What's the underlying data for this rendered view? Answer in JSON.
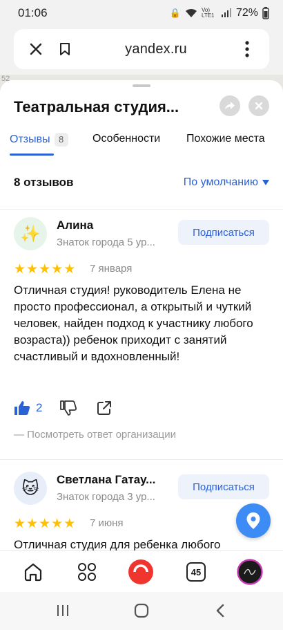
{
  "status": {
    "time": "01:06",
    "battery": "72%",
    "network": "Vo) LTE1"
  },
  "browser": {
    "url": "yandex.ru",
    "close_icon": "close-icon",
    "bookmark_icon": "bookmark-icon",
    "menu_icon": "more-vertical-icon"
  },
  "map": {
    "fragment": "52"
  },
  "place": {
    "title": "Театральная студия..."
  },
  "tabs": [
    {
      "label": "Отзывы",
      "badge": "8",
      "active": true
    },
    {
      "label": "Особенности",
      "active": false
    },
    {
      "label": "Похожие места",
      "active": false
    }
  ],
  "reviews_header": {
    "count": "8 отзывов",
    "sort": "По умолчанию"
  },
  "reviews": [
    {
      "avatar": "✨",
      "avatar_icon": "sparkles-icon",
      "name": "Алина",
      "level": "Знаток города 5 ур...",
      "subscribe": "Подписаться",
      "rating": 5,
      "date": "7 января",
      "text": "Отличная студия! руководитель Елена не просто профессионал, а открытый и чуткий человек, найден подход к участнику любого возраста)) ребенок приходит с занятий счастливый и вдохновленный!",
      "likes": "2",
      "org_reply": "— Посмотреть ответ организации"
    },
    {
      "avatar": "🐱",
      "avatar_icon": "cat-icon",
      "name": "Светлана Гатау...",
      "level": "Знаток города 3 ур...",
      "subscribe": "Подписаться",
      "rating": 5,
      "date": "7 июня",
      "text": "Отличная студия для ребенка любого"
    }
  ],
  "bottom_nav": {
    "tabs_count": "45"
  },
  "colors": {
    "accent": "#2a62d6",
    "star": "#ffc000",
    "alice": "#f0352e",
    "fab": "#3d8bf5"
  }
}
